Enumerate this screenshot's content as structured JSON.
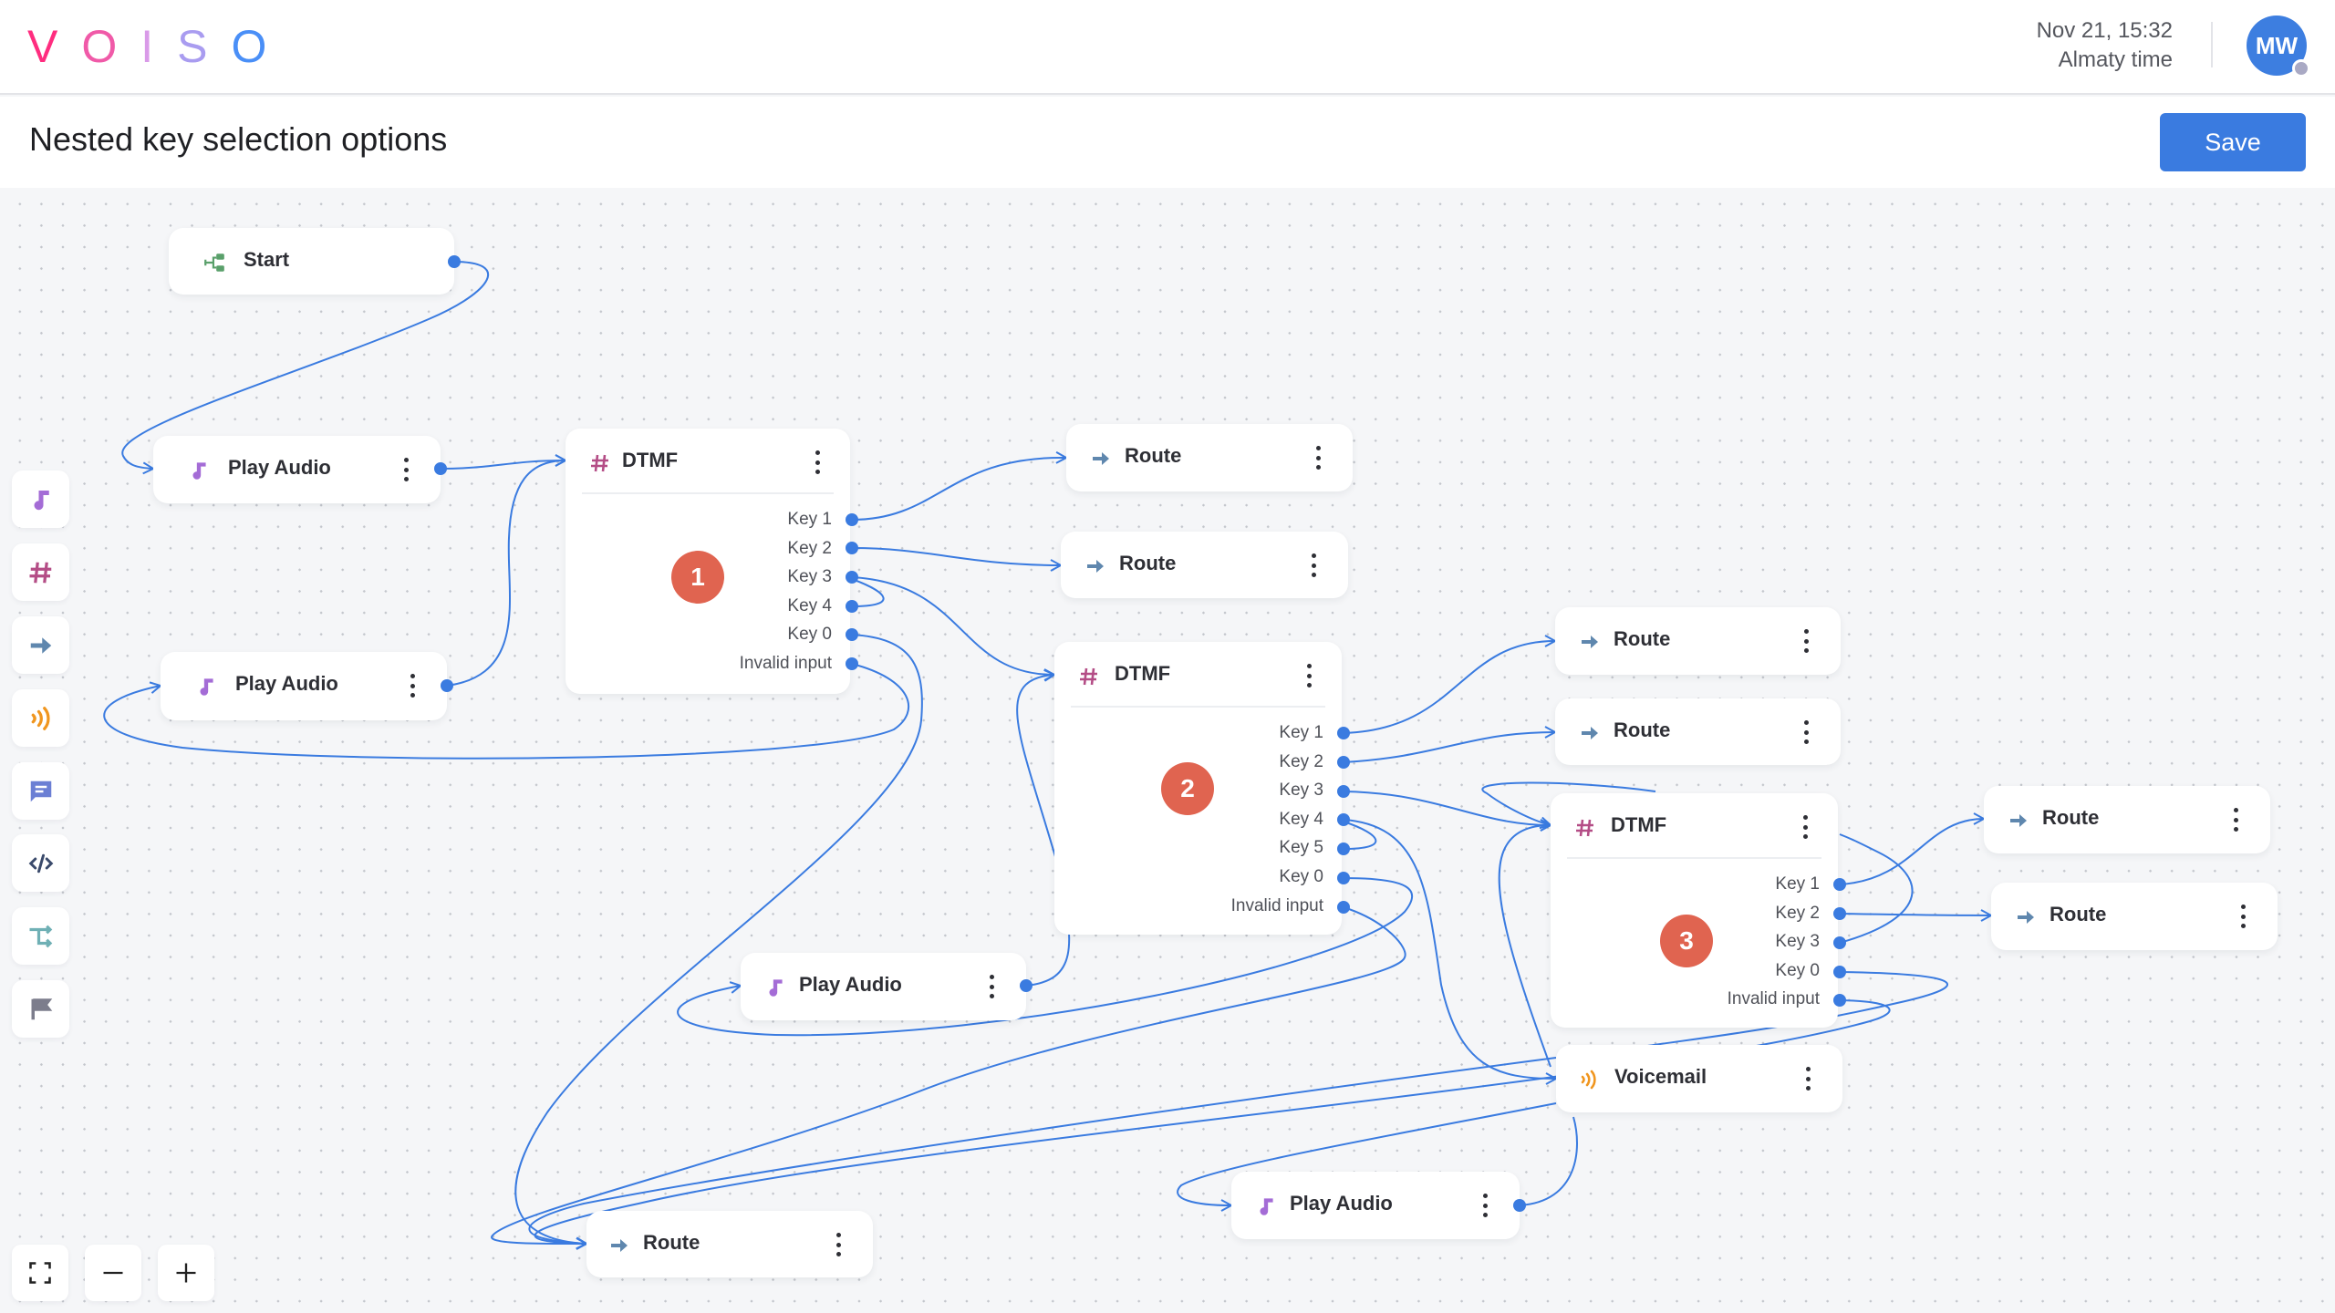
{
  "app": {
    "logo_letters": [
      "V",
      "O",
      "I",
      "S",
      "O"
    ],
    "logo_colors": [
      "#ff2d7f",
      "#f05aa8",
      "#d99ae8",
      "#a99cf0",
      "#4a8ff7"
    ]
  },
  "header": {
    "date_time": "Nov 21, 15:32",
    "timezone": "Almaty time",
    "avatar_initials": "MW",
    "avatar_color": "#3d7ee0",
    "presence_color": "#a9a9c4"
  },
  "subheader": {
    "title": "Nested key selection options",
    "save_label": "Save",
    "save_color": "#3a7be0"
  },
  "toolbar": {
    "items": [
      {
        "name": "play-audio-tool",
        "icon": "music-note-icon",
        "color": "#a46cd6"
      },
      {
        "name": "dtmf-tool",
        "icon": "hash-icon",
        "color": "#b44d86"
      },
      {
        "name": "route-tool",
        "icon": "arrow-right-icon",
        "color": "#5f87ae"
      },
      {
        "name": "voicemail-tool",
        "icon": "voicemail-waves-icon",
        "color": "#f0961f"
      },
      {
        "name": "message-tool",
        "icon": "chat-bubble-icon",
        "color": "#6b7fd4"
      },
      {
        "name": "code-tool",
        "icon": "code-icon",
        "color": "#3a4a6b"
      },
      {
        "name": "transfer-tool",
        "icon": "transfer-arrows-icon",
        "color": "#6fb0b5"
      },
      {
        "name": "end-tool",
        "icon": "flag-icon",
        "color": "#7c7d8c"
      }
    ]
  },
  "zoom_controls": {
    "fit_icon": "fit-view-icon",
    "zoom_out_icon": "minus-icon",
    "zoom_in_icon": "plus-icon"
  },
  "edge_color": "#3a7be0",
  "nodes": {
    "start": {
      "label": "Start",
      "icon": "start-branch-icon",
      "icon_color": "#5aa06b"
    },
    "play_audio_1": {
      "label": "Play Audio"
    },
    "play_audio_2": {
      "label": "Play Audio"
    },
    "play_audio_3": {
      "label": "Play Audio"
    },
    "play_audio_4": {
      "label": "Play Audio"
    },
    "dtmf_1": {
      "label": "DTMF",
      "badge": "1",
      "outputs": [
        "Key 1",
        "Key 2",
        "Key 3",
        "Key 4",
        "Key 0",
        "Invalid input"
      ]
    },
    "dtmf_2": {
      "label": "DTMF",
      "badge": "2",
      "outputs": [
        "Key 1",
        "Key 2",
        "Key 3",
        "Key 4",
        "Key 5",
        "Key 0",
        "Invalid input"
      ]
    },
    "dtmf_3": {
      "label": "DTMF",
      "badge": "3",
      "outputs": [
        "Key 1",
        "Key 2",
        "Key 3",
        "Key 0",
        "Invalid input"
      ]
    },
    "route_a": {
      "label": "Route"
    },
    "route_b": {
      "label": "Route"
    },
    "route_c": {
      "label": "Route"
    },
    "route_d": {
      "label": "Route"
    },
    "route_e": {
      "label": "Route"
    },
    "route_f": {
      "label": "Route"
    },
    "route_g": {
      "label": "Route"
    },
    "voicemail": {
      "label": "Voicemail"
    }
  }
}
